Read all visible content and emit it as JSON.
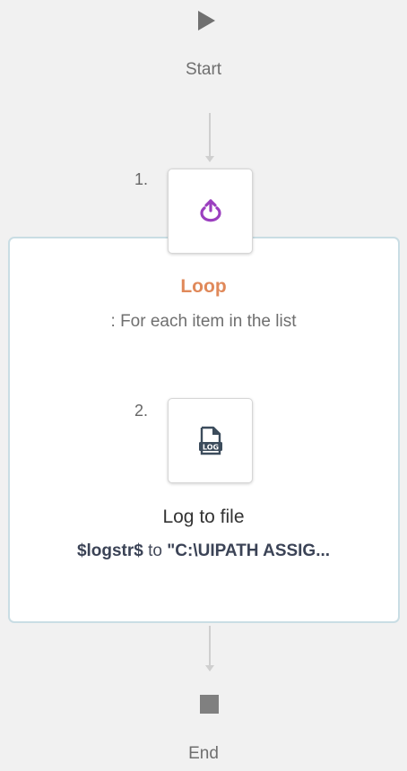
{
  "flow": {
    "start_label": "Start",
    "end_label": "End"
  },
  "steps": [
    {
      "number": "1.",
      "icon": "loop-icon",
      "title": "Loop",
      "description": ": For each item in the list"
    },
    {
      "number": "2.",
      "icon": "log-file-icon",
      "icon_text": "LOG",
      "title": "Log to file",
      "variable": "$logstr$",
      "connector_word": "to",
      "path": "\"C:\\UIPATH ASSIG..."
    }
  ],
  "colors": {
    "background": "#f1f1f1",
    "loop_accent": "#e0895a",
    "loop_icon": "#9b3fbf",
    "container_border": "#c9dde4",
    "log_icon": "#3c4c5c"
  }
}
